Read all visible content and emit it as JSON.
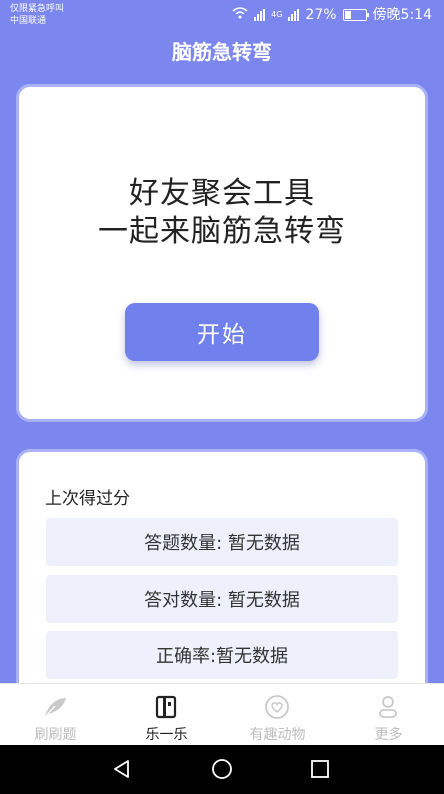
{
  "status_bar": {
    "carrier_line1": "仅限紧急呼叫",
    "carrier_line2": "中国联通",
    "battery": "27%",
    "time": "傍晚5:14",
    "network": "4G"
  },
  "header": {
    "title": "脑筋急转弯"
  },
  "hero": {
    "line1": "好友聚会工具",
    "line2": "一起来脑筋急转弯",
    "start_label": "开始"
  },
  "last_score": {
    "title": "上次得过分",
    "rows": [
      "答题数量: 暂无数据",
      "答对数量: 暂无数据",
      "正确率:暂无数据"
    ]
  },
  "tabs": [
    {
      "label": "刷刷题",
      "icon": "feather-icon"
    },
    {
      "label": "乐一乐",
      "icon": "book-icon"
    },
    {
      "label": "有趣动物",
      "icon": "heart-icon"
    },
    {
      "label": "更多",
      "icon": "person-icon"
    }
  ],
  "colors": {
    "accent": "#7080ec",
    "background": "#7b86ee"
  }
}
